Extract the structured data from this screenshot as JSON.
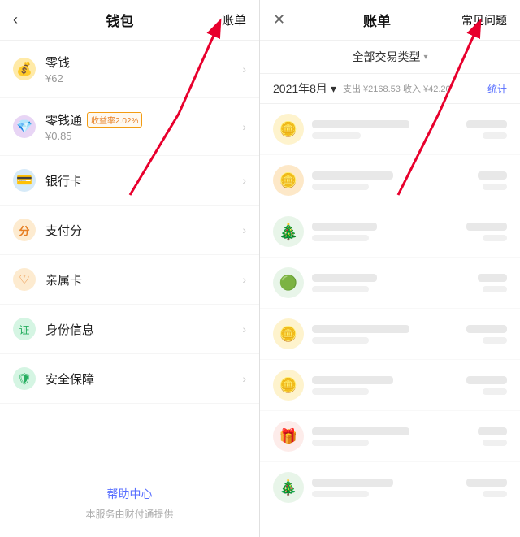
{
  "left": {
    "back_icon": "‹",
    "title": "钱包",
    "account_label": "账单",
    "menu": [
      {
        "id": "lingqian",
        "icon": "💰",
        "icon_class": "icon-lingqian",
        "title": "零钱",
        "badge": null,
        "sub": "¥62",
        "has_arrow": true
      },
      {
        "id": "lingqiantong",
        "icon": "💎",
        "icon_class": "icon-lingqiantong",
        "title": "零钱通",
        "badge": "收益率2.02%",
        "sub": "¥0.85",
        "has_arrow": true
      },
      {
        "id": "yinhangka",
        "icon": "💳",
        "icon_class": "icon-yinhangka",
        "title": "银行卡",
        "badge": null,
        "sub": null,
        "has_arrow": true
      },
      {
        "id": "zhifufen",
        "icon": "⊙",
        "icon_class": "icon-zhifufen",
        "title": "支付分",
        "badge": null,
        "sub": null,
        "has_arrow": true
      },
      {
        "id": "qinshu",
        "icon": "♡",
        "icon_class": "icon-qinshu",
        "title": "亲属卡",
        "badge": null,
        "sub": null,
        "has_arrow": true
      },
      {
        "id": "shenfen",
        "icon": "🪪",
        "icon_class": "icon-shenfen",
        "title": "身份信息",
        "badge": null,
        "sub": null,
        "has_arrow": true
      },
      {
        "id": "anquan",
        "icon": "🛡",
        "icon_class": "icon-anquan",
        "title": "安全保障",
        "badge": null,
        "sub": null,
        "has_arrow": true
      }
    ],
    "footer": {
      "help": "帮助中心",
      "note": "本服务由财付通提供"
    }
  },
  "right": {
    "close_icon": "✕",
    "title": "账单",
    "faq_label": "常见问题",
    "filter": {
      "label": "全部交易类型",
      "chevron": "▾"
    },
    "month": {
      "label": "2021年8月",
      "chevron": "▾",
      "stats": "支出 ¥2168.53 收入 ¥42.20",
      "stats_link": "统计"
    },
    "transactions": [
      {
        "icon": "🟡",
        "bg": "#fef3cd"
      },
      {
        "icon": "🟠",
        "bg": "#fde8c8"
      },
      {
        "icon": "🎄",
        "bg": "#e8f5e9"
      },
      {
        "icon": "🟢",
        "bg": "#e8f5e9"
      },
      {
        "icon": "🟡",
        "bg": "#fef3cd"
      },
      {
        "icon": "🟡",
        "bg": "#fef3cd"
      },
      {
        "icon": "🔴",
        "bg": "#fdecea"
      },
      {
        "icon": "🎄",
        "bg": "#e8f5e9"
      }
    ]
  },
  "arrows": {
    "left_arrow": "pointing right toward 账单 in left header",
    "right_arrow": "pointing right toward 常见问题 in right header"
  }
}
